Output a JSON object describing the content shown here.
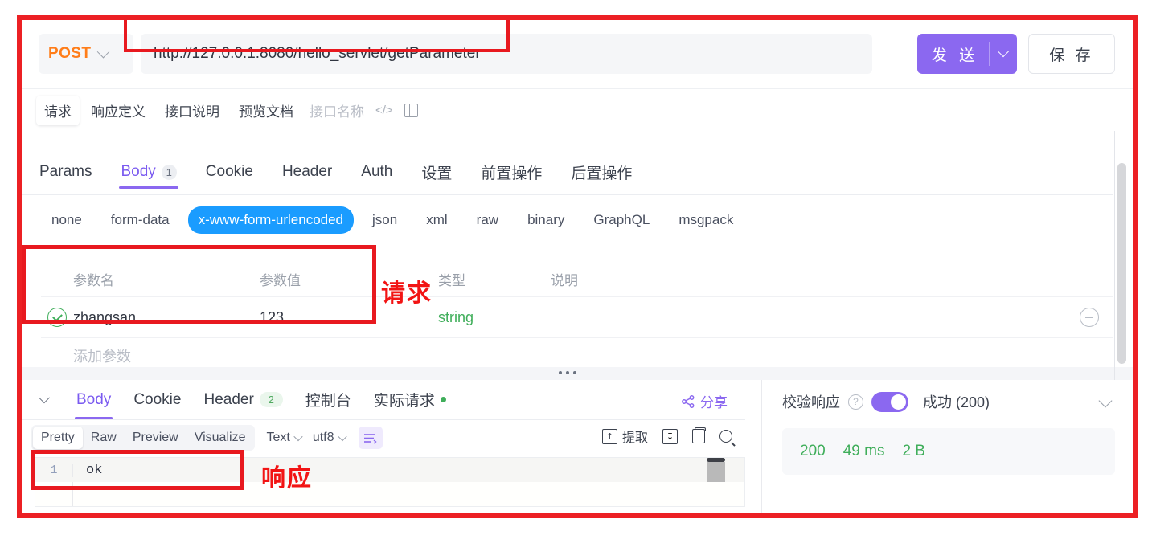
{
  "request_bar": {
    "method": "POST",
    "url": "http://127.0.0.1:8080/hello_servlet/getParameter",
    "send_label": "发 送",
    "save_label": "保 存"
  },
  "doc_tabs": {
    "items": [
      "请求",
      "响应定义",
      "接口说明",
      "预览文档"
    ],
    "active": "请求",
    "name_placeholder": "接口名称",
    "code_icon": "</>",
    "split_icon": "panel-icon"
  },
  "request_tabs": {
    "items": [
      {
        "label": "Params",
        "badge": ""
      },
      {
        "label": "Body",
        "badge": "1"
      },
      {
        "label": "Cookie",
        "badge": ""
      },
      {
        "label": "Header",
        "badge": ""
      },
      {
        "label": "Auth",
        "badge": ""
      },
      {
        "label": "设置",
        "badge": ""
      },
      {
        "label": "前置操作",
        "badge": ""
      },
      {
        "label": "后置操作",
        "badge": ""
      }
    ],
    "active": "Body"
  },
  "body_types": {
    "items": [
      "none",
      "form-data",
      "x-www-form-urlencoded",
      "json",
      "xml",
      "raw",
      "binary",
      "GraphQL",
      "msgpack"
    ],
    "active": "x-www-form-urlencoded"
  },
  "params_table": {
    "headers": [
      "参数名",
      "参数值",
      "类型",
      "说明"
    ],
    "rows": [
      {
        "checked": true,
        "name": "zhangsan",
        "value": "123",
        "type": "string",
        "desc": ""
      }
    ],
    "add_row_placeholder": "添加参数"
  },
  "response": {
    "tabs": [
      {
        "label": "Body",
        "badge": "",
        "dot": false
      },
      {
        "label": "Cookie",
        "badge": "",
        "dot": false
      },
      {
        "label": "Header",
        "badge": "2",
        "dot": false
      },
      {
        "label": "控制台",
        "badge": "",
        "dot": false
      },
      {
        "label": "实际请求",
        "badge": "",
        "dot": true
      }
    ],
    "active": "Body",
    "share_label": "分享",
    "view_modes": [
      "Pretty",
      "Raw",
      "Preview",
      "Visualize"
    ],
    "view_active": "Pretty",
    "format_select": "Text",
    "encoding_select": "utf8",
    "wrap_icon": "wrap-lines-icon",
    "extract_label": "提取",
    "download_icon": "download-icon",
    "copy_icon": "copy-icon",
    "search_icon": "search-icon",
    "body_lines": [
      {
        "no": "1",
        "text": "ok"
      }
    ]
  },
  "validate": {
    "label": "校验响应",
    "help_icon": "question-icon",
    "toggle_on": true,
    "status": "成功 (200)",
    "stats": [
      "200",
      "49 ms",
      "2 B"
    ]
  },
  "annotations": {
    "request_note": "请求",
    "response_note": "响应",
    "highlight_color": "#e8191f"
  }
}
